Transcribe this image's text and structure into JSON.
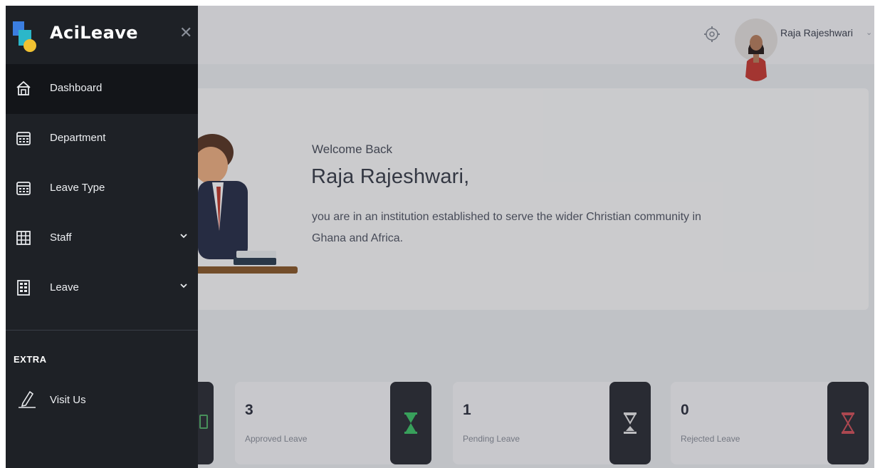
{
  "brand": {
    "name": "AciLeave"
  },
  "sidebar": {
    "items": [
      {
        "label": "Dashboard",
        "icon": "home-icon",
        "active": true
      },
      {
        "label": "Department",
        "icon": "calendar-icon"
      },
      {
        "label": "Leave Type",
        "icon": "calendar-icon"
      },
      {
        "label": "Staff",
        "icon": "grid-icon",
        "has_submenu": true
      },
      {
        "label": "Leave",
        "icon": "building-icon",
        "has_submenu": true
      }
    ],
    "section_title": "EXTRA",
    "extra_items": [
      {
        "label": "Visit Us",
        "icon": "pen-icon"
      }
    ]
  },
  "header": {
    "user_name": "Raja Rajeshwari",
    "icons": [
      "gear-icon",
      "avatar",
      "chevron-down-icon"
    ]
  },
  "welcome": {
    "greeting": "Welcome Back",
    "name": "Raja Rajeshwari,",
    "description": "you are in an institution established to serve the wider Christian community in Ghana and Africa."
  },
  "stats": [
    {
      "value": "3",
      "label": "Approved Leave",
      "icon": "hourglass-icon",
      "color": "#3fc46a"
    },
    {
      "value": "1",
      "label": "Pending Leave",
      "icon": "hourglass-icon",
      "color": "#e8e8ea"
    },
    {
      "value": "0",
      "label": "Rejected Leave",
      "icon": "hourglass-icon",
      "color": "#d2525c"
    }
  ],
  "colors": {
    "sidebar_bg": "#1e2126",
    "sidebar_active": "#131519",
    "stat_icon_bg": "#2c2f36"
  }
}
